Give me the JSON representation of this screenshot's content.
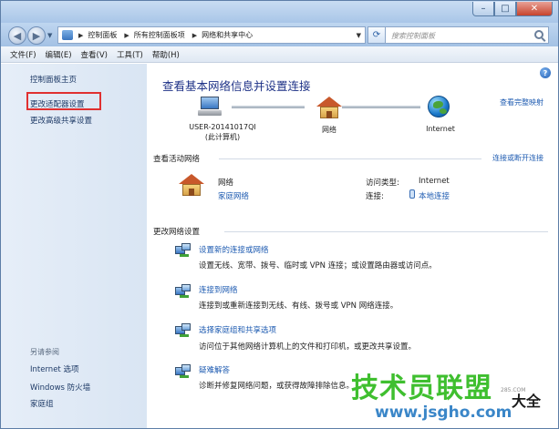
{
  "window": {
    "controls": {
      "minimize": "–",
      "maximize": "□",
      "close": "✕"
    }
  },
  "address": {
    "crumbs": [
      "控制面板",
      "所有控制面板项",
      "网络和共享中心"
    ],
    "search_placeholder": "搜索控制面板"
  },
  "menu": [
    "文件(F)",
    "编辑(E)",
    "查看(V)",
    "工具(T)",
    "帮助(H)"
  ],
  "sidebar": {
    "home": "控制面板主页",
    "adapter_settings": "更改适配器设置",
    "advanced_sharing": "更改高级共享设置",
    "see_also": "另请参阅",
    "links": [
      "Internet 选项",
      "Windows 防火墙",
      "家庭组"
    ]
  },
  "main": {
    "title": "查看基本网络信息并设置连接",
    "full_map": "查看完整映射",
    "map": {
      "computer_name": "USER-20141017QI",
      "computer_sub": "(此计算机)",
      "network": "网络",
      "internet": "Internet"
    },
    "active": {
      "heading": "查看活动网络",
      "connect_disconnect": "连接或断开连接",
      "network_name": "网络",
      "network_type": "家庭网络",
      "access_type_label": "访问类型:",
      "access_type_value": "Internet",
      "connections_label": "连接:",
      "connections_value": "本地连接"
    },
    "change": {
      "heading": "更改网络设置",
      "tasks": [
        {
          "link": "设置新的连接或网络",
          "desc": "设置无线、宽带、拨号、临时或 VPN 连接；或设置路由器或访问点。"
        },
        {
          "link": "连接到网络",
          "desc": "连接到或重新连接到无线、有线、拨号或 VPN 网络连接。"
        },
        {
          "link": "选择家庭组和共享选项",
          "desc": "访问位于其他网络计算机上的文件和打印机，或更改共享设置。"
        },
        {
          "link": "疑难解答",
          "desc": "诊断并修复网络问题，或获得故障排除信息。"
        }
      ]
    }
  },
  "watermark": {
    "title": "技术员联盟",
    "suffix": "大全",
    "small": "285.COM",
    "url": "www.jsgho.com"
  }
}
